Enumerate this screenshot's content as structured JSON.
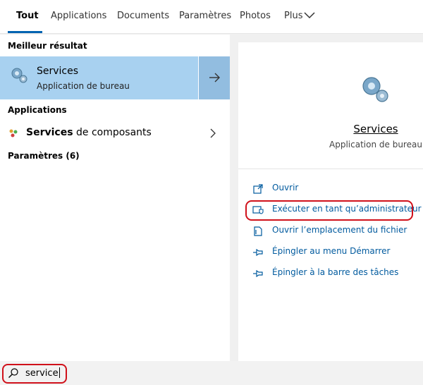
{
  "tabs": [
    {
      "label": "Tout",
      "active": true
    },
    {
      "label": "Applications"
    },
    {
      "label": "Documents"
    },
    {
      "label": "Paramètres"
    },
    {
      "label": "Photos"
    },
    {
      "label": "Plus"
    }
  ],
  "left": {
    "best_header": "Meilleur résultat",
    "best": {
      "title": "Services",
      "subtitle": "Application de bureau"
    },
    "apps_header": "Applications",
    "app_item": {
      "bold": "Services",
      "rest": " de composants"
    },
    "settings_header": "Paramètres (6)"
  },
  "right": {
    "title": "Services",
    "subtitle": "Application de bureau",
    "actions": [
      {
        "label": "Ouvrir",
        "icon": "open-icon"
      },
      {
        "label": "Exécuter en tant qu’administrateur",
        "icon": "shield-admin-icon"
      },
      {
        "label": "Ouvrir l’emplacement du fichier",
        "icon": "folder-icon"
      },
      {
        "label": "Épingler au menu Démarrer",
        "icon": "pin-icon"
      },
      {
        "label": "Épingler à la barre des tâches",
        "icon": "pin-icon"
      }
    ]
  },
  "search": {
    "value": "service"
  },
  "colors": {
    "accent": "#0063b1",
    "selected": "#a8d1f0",
    "annotation": "#d0111b",
    "link": "#005a9e"
  }
}
